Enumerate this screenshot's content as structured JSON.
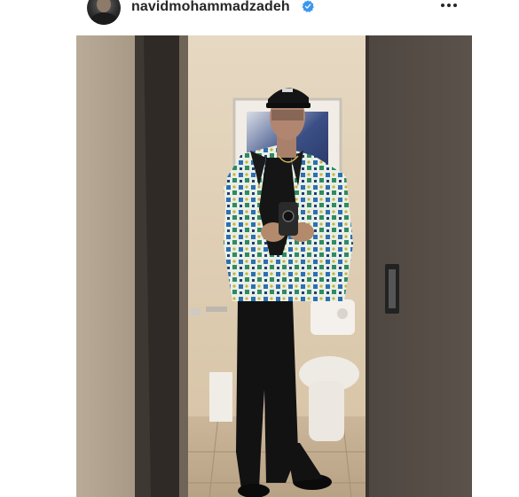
{
  "post": {
    "username": "navidmohammadzadeh",
    "verified": true,
    "more_icon": "more-horizontal-icon",
    "avatar_icon": "profile-avatar"
  },
  "photo": {
    "description_icon": "mirror-selfie-photo"
  },
  "colors": {
    "text": "#262626",
    "verified_blue": "#3897f0",
    "background": "#ffffff"
  }
}
